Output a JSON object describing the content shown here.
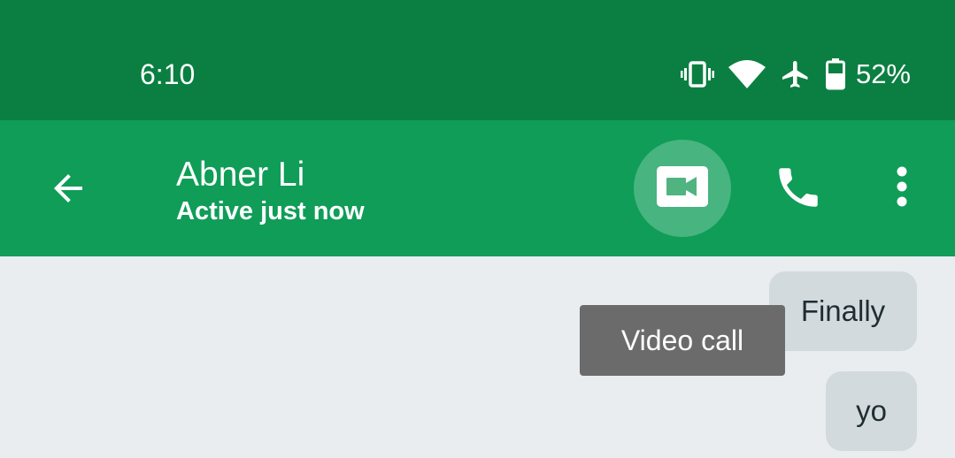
{
  "status_bar": {
    "time": "6:10",
    "battery_percent": "52%",
    "icons": [
      "vibrate-icon",
      "wifi-icon",
      "airplane-icon",
      "battery-icon"
    ]
  },
  "toolbar": {
    "contact_name": "Abner Li",
    "status": "Active just now",
    "icons": [
      "back-arrow-icon",
      "video-camera-icon",
      "phone-icon",
      "more-vert-icon"
    ]
  },
  "messages": [
    {
      "text": "Finally"
    },
    {
      "text": "yo"
    }
  ],
  "tooltip": {
    "text": "Video call"
  },
  "colors": {
    "status_bar_bg": "#0b7f41",
    "toolbar_bg": "#0f9d58",
    "chat_bg": "#e9edf0",
    "bubble_bg": "#d2dadd",
    "tooltip_bg": "#6b6b6b"
  }
}
